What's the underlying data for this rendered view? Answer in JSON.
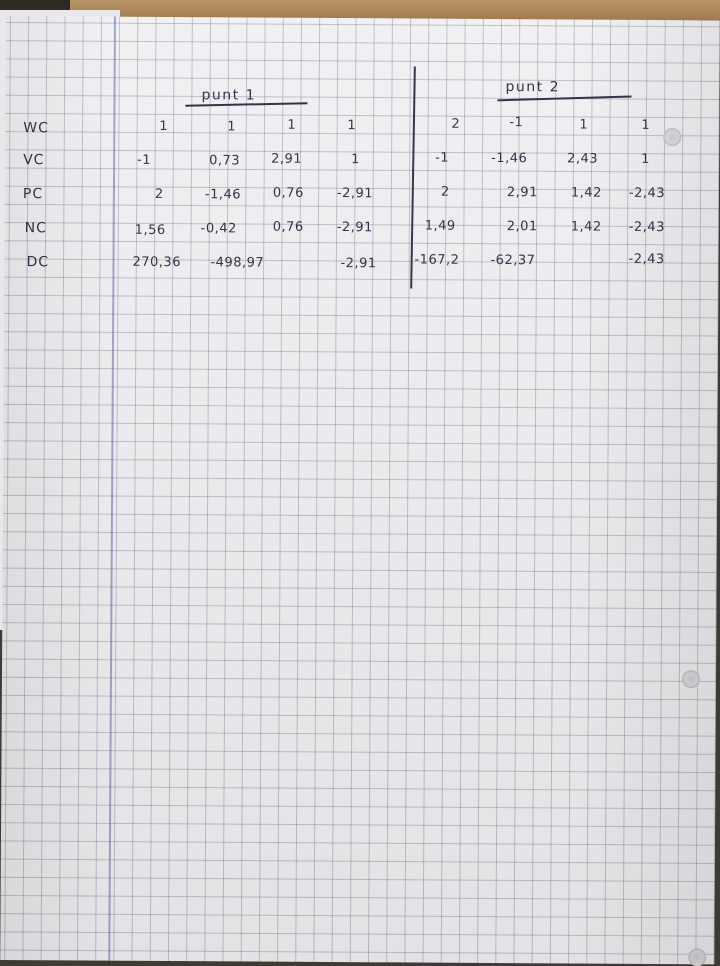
{
  "headings": {
    "left": "punt 1",
    "right": "punt 2"
  },
  "row_labels": [
    "WC",
    "VC",
    "PC",
    "NC",
    "DC"
  ],
  "punt1": {
    "WC": [
      "1",
      "1",
      "1",
      "1"
    ],
    "VC": [
      "-1",
      "0,73",
      "2,91",
      "1"
    ],
    "PC": [
      "2",
      "-1,46",
      "0,76",
      "-2,91"
    ],
    "NC": [
      "1,56",
      "-0,42",
      "0,76",
      "-2,91"
    ],
    "DC": [
      "270,36",
      "-498,97",
      "",
      "-2,91"
    ]
  },
  "punt2": {
    "WC": [
      "2",
      "-1",
      "1",
      "1"
    ],
    "VC": [
      "-1",
      "-1,46",
      "2,43",
      "1"
    ],
    "PC": [
      "2",
      "2,91",
      "1,42",
      "-2,43"
    ],
    "NC": [
      "1,49",
      "2,01",
      "1,42",
      "-2,43"
    ],
    "DC": [
      "-167,2",
      "-62,37",
      "",
      "-2,43"
    ]
  }
}
